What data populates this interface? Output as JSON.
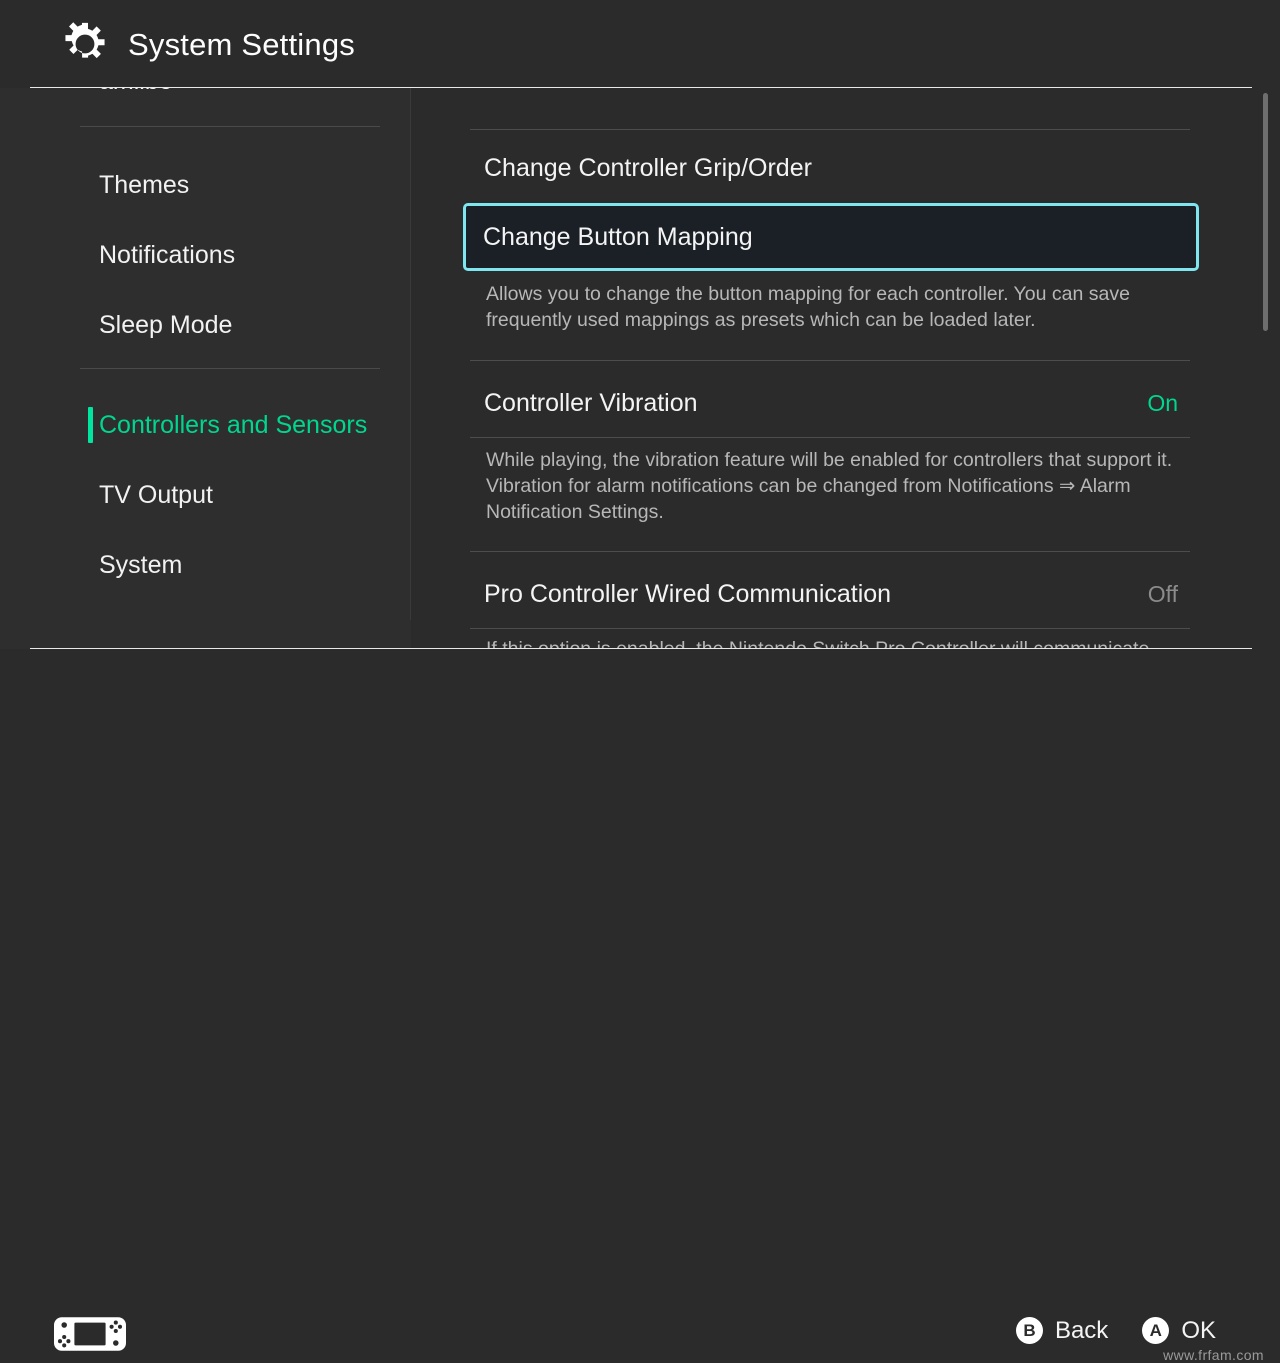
{
  "header": {
    "title": "System Settings",
    "icon": "gear-icon"
  },
  "sidebar": {
    "items": [
      {
        "label": "amiibo",
        "active": false,
        "clipped": true
      },
      {
        "label": "Themes",
        "active": false
      },
      {
        "label": "Notifications",
        "active": false
      },
      {
        "label": "Sleep Mode",
        "active": false
      },
      {
        "label": "Controllers and Sensors",
        "active": true
      },
      {
        "label": "TV Output",
        "active": false
      },
      {
        "label": "System",
        "active": false
      }
    ]
  },
  "content": {
    "rows": [
      {
        "title": "Change Controller Grip/Order",
        "value": "",
        "description": "",
        "selected": false
      },
      {
        "title": "Change Button Mapping",
        "value": "",
        "description": "Allows you to change the button mapping for each controller. You can save frequently used mappings as presets which can be loaded later.",
        "selected": true
      },
      {
        "title": "Controller Vibration",
        "value": "On",
        "value_state": "on",
        "description": "While playing, the vibration feature will be enabled for controllers that support it. Vibration for alarm notifications can be changed from Notifications ⇒ Alarm Notification Settings.",
        "selected": false
      },
      {
        "title": "Pro Controller Wired Communication",
        "value": "Off",
        "value_state": "off",
        "description": "If this option is enabled, the Nintendo Switch Pro Controller will communicate",
        "selected": false
      }
    ]
  },
  "footer": {
    "console_icon": "switch-console-icon",
    "hints": [
      {
        "button": "B",
        "label": "Back"
      },
      {
        "button": "A",
        "label": "OK"
      }
    ],
    "watermark": "www.frfam.com"
  },
  "colors": {
    "accent_teal": "#00d68f",
    "selection_cyan": "#7fe6f0",
    "background": "#2b2b2b",
    "sidebar_background": "#2e2e2e",
    "selected_row_fill": "#1b2027",
    "muted_text": "#b7b7b7",
    "off_value": "#8b8b8b"
  },
  "scrollbar": {
    "thumb_top_pct": 1,
    "thumb_height_pct": 36
  }
}
